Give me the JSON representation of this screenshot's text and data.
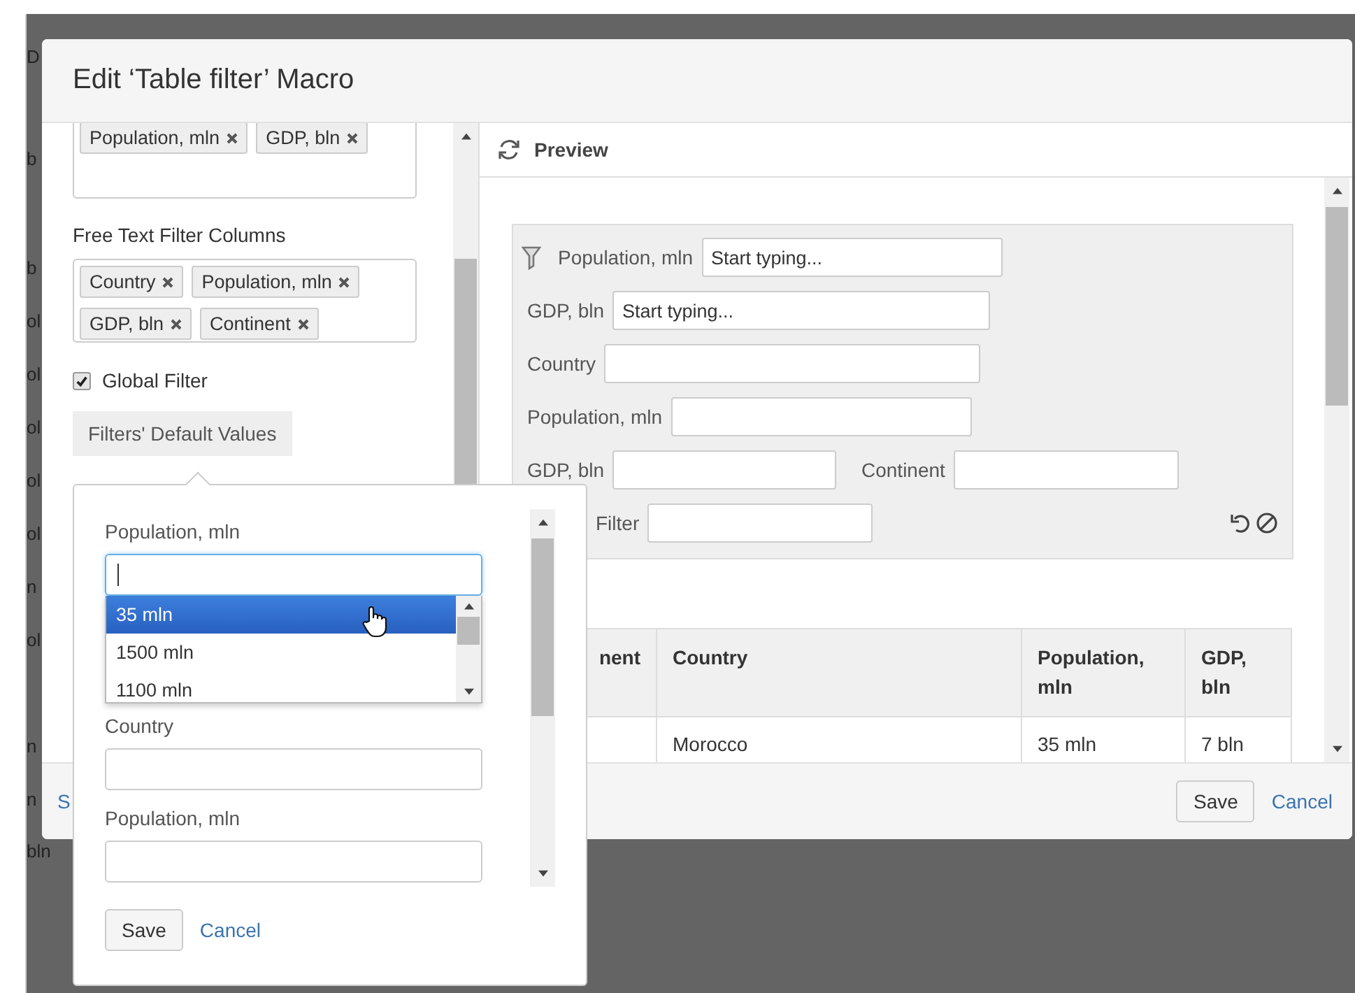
{
  "window": {
    "title": "Edit ‘Table filter’ Macro"
  },
  "background": {
    "fragments": [
      "D",
      "b",
      "b",
      "ol",
      "ol",
      "ol",
      "ol",
      "ol",
      "n",
      "ol",
      "n",
      "n",
      "bln"
    ]
  },
  "settings": {
    "top_tags": [
      "Population, mln",
      "GDP, bln"
    ],
    "free_text_label": "Free Text Filter Columns",
    "free_text_tags": [
      "Country",
      "Population, mln",
      "GDP, bln",
      "Continent"
    ],
    "global_filter": {
      "label": "Global Filter",
      "checked": true
    },
    "defaults_button": "Filters' Default Values"
  },
  "preview": {
    "title": "Preview",
    "filters": [
      [
        {
          "label": "Population, mln",
          "placeholder": "Start typing..."
        }
      ],
      [
        {
          "label": "GDP, bln",
          "placeholder": "Start typing..."
        }
      ],
      [
        {
          "label": "Country"
        }
      ],
      [
        {
          "label": "Population, mln"
        }
      ],
      [
        {
          "label": "GDP, bln"
        },
        {
          "label": "Continent"
        }
      ],
      [
        {
          "label": "Filter",
          "kind": "global"
        }
      ]
    ],
    "table": {
      "columns": [
        "nent",
        "Country",
        "Population, mln",
        "GDP, bln"
      ],
      "rows": [
        {
          "country": "Morocco",
          "population": "35 mln",
          "gdp": "7 bln"
        }
      ]
    }
  },
  "footer": {
    "link": "S",
    "save": "Save",
    "cancel": "Cancel"
  },
  "popover": {
    "fields": [
      {
        "label": "Population, mln",
        "focused": true,
        "suggestions": [
          {
            "text": "35 mln",
            "selected": true
          },
          {
            "text": "1500 mln",
            "selected": false
          },
          {
            "text": "1100 mln",
            "selected": false
          }
        ]
      },
      {
        "label": "Country",
        "focused": false
      },
      {
        "label": "Population, mln",
        "focused": false
      }
    ],
    "save": "Save",
    "cancel": "Cancel"
  }
}
